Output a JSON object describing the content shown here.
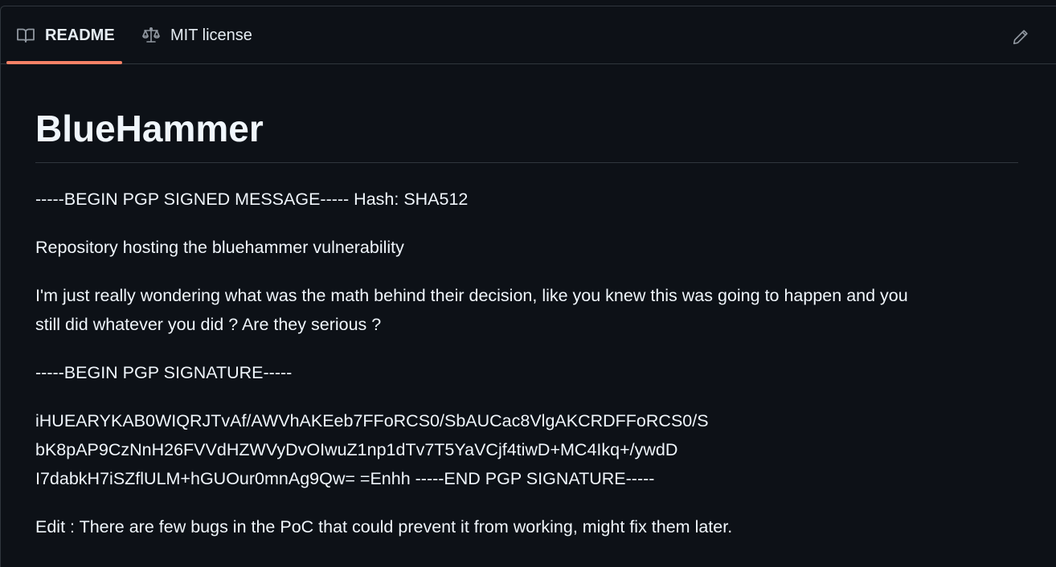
{
  "tabs": {
    "readme_label": "README",
    "license_label": "MIT license"
  },
  "readme": {
    "title": "BlueHammer",
    "paragraphs": [
      "-----BEGIN PGP SIGNED MESSAGE----- Hash: SHA512",
      "Repository hosting the bluehammer vulnerability",
      "I'm just really wondering what was the math behind their decision, like you knew this was going to happen and you\nstill did whatever you did ? Are they serious ?",
      "-----BEGIN PGP SIGNATURE-----",
      "iHUEARYKAB0WIQRJTvAf/AWVhAKEeb7FFoRCS0/SbAUCac8VlgAKCRDFFoRCS0/S\nbK8pAP9CzNnH26FVVdHZWVyDvOIwuZ1np1dTv7T5YaVCjf4tiwD+MC4Ikq+/ywdD\nI7dabkH7iSZflULM+hGUOur0mnAg9Qw= =Enhh -----END PGP SIGNATURE-----",
      "Edit : There are few bugs in the PoC that could prevent it from working, might fix them later."
    ]
  },
  "icons": {
    "readme_tab": "book-icon",
    "license_tab": "law-scale-icon",
    "edit": "pencil-icon"
  },
  "colors": {
    "background": "#0d1117",
    "border": "#30363d",
    "tab_underline": "#f78166",
    "text": "#f0f6fc",
    "icon": "#9198a1"
  }
}
